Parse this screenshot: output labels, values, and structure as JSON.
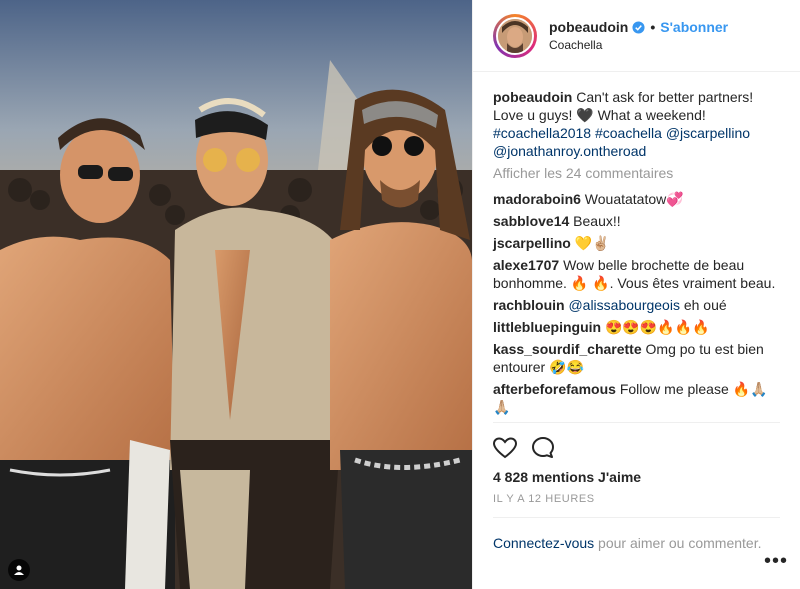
{
  "post": {
    "username": "pobeaudoin",
    "follow_label": "S'abonner",
    "location": "Coachella",
    "caption": {
      "author": "pobeaudoin",
      "text": "Can't ask for better partners! Love u guys! 🖤 What a weekend! ",
      "tags": [
        "#coachella2018",
        "#coachella",
        "@jscarpellino",
        "@jonathanroy.ontheroad"
      ]
    },
    "show_comments_label": "Afficher les 24 commentaires",
    "comments": [
      {
        "user": "madoraboin6",
        "text": "Wouatatatow💞"
      },
      {
        "user": "sabblove14",
        "text": "Beaux!!"
      },
      {
        "user": "jscarpellino",
        "text": "💛✌🏼"
      },
      {
        "user": "alexe1707",
        "text": "Wow belle brochette de beau bonhomme. 🔥 🔥. Vous êtes vraiment beau."
      },
      {
        "user": "rachblouin",
        "mention": "@alissabourgeois",
        "text": " eh oué"
      },
      {
        "user": "littlebluepinguin",
        "text": "😍😍😍🔥🔥🔥"
      },
      {
        "user": "kass_sourdif_charette",
        "text": "Omg po tu est bien entourer 🤣😂"
      },
      {
        "user": "afterbeforefamous",
        "text": "Follow me please 🔥🙏🏼🙏🏼"
      }
    ],
    "likes": "4 828 mentions J'aime",
    "timestamp": "IL Y A 12 HEURES",
    "login_link": "Connectez-vous",
    "login_rest": " pour aimer ou commenter.",
    "more_label": "•••"
  },
  "icons": {
    "like": "heart-outline-icon",
    "comment": "comment-bubble-icon",
    "verified": "verified-badge-icon",
    "tag": "user-tag-icon"
  },
  "colors": {
    "link_blue": "#3897f0",
    "tag_dark_blue": "#003569",
    "muted": "#999999"
  }
}
